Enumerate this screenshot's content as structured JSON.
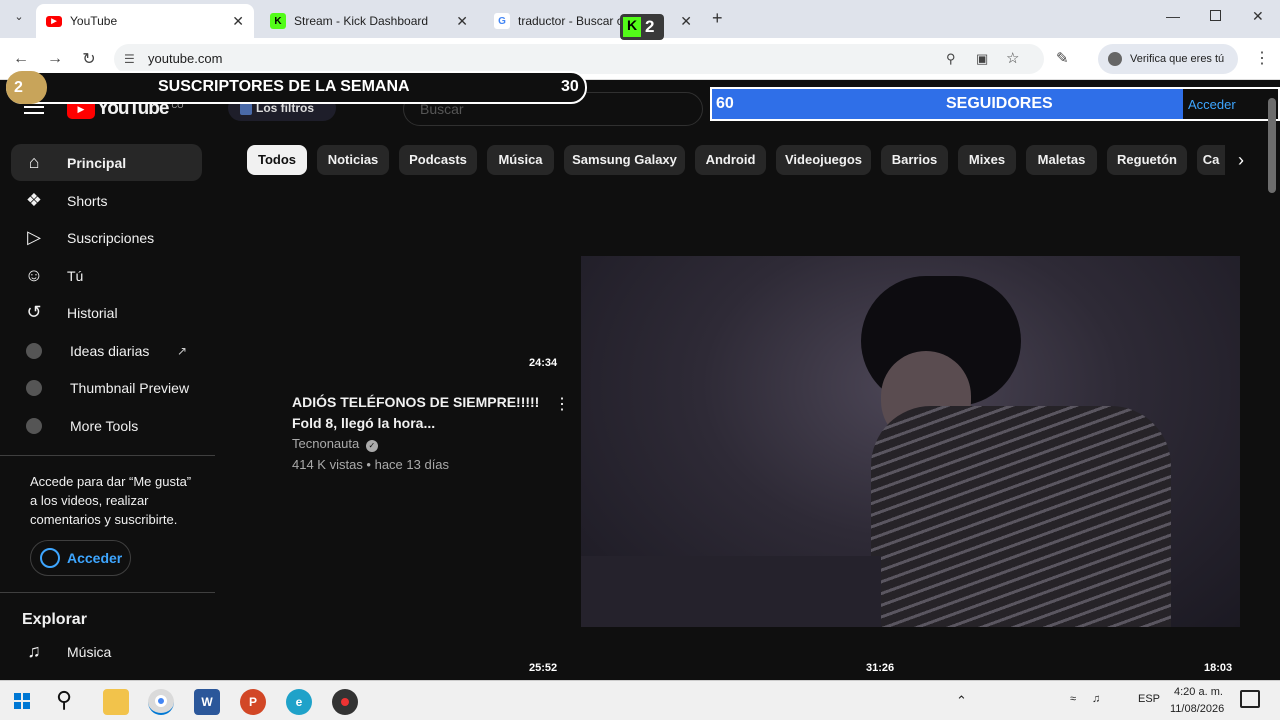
{
  "browser": {
    "tabs": [
      {
        "title": "YouTube",
        "icon": "youtube-icon"
      },
      {
        "title": "Stream - Kick Dashboard",
        "icon": "kick-icon"
      },
      {
        "title": "traductor - Buscar con Google",
        "icon": "google-icon"
      }
    ],
    "new_tab": "+",
    "url": "youtube.com",
    "verify_label": "Verifica que eres tú"
  },
  "overlay": {
    "subs_rank": "2",
    "subs_title": "SUSCRIPTORES DE LA SEMANA",
    "subs_count": "30",
    "followers_count": "60",
    "followers_title": "SEGUIDORES",
    "kick_badge": "2"
  },
  "youtube": {
    "logo": "YouTube",
    "country": "CO",
    "filter_ext": "Los filtros",
    "search_placeholder": "Buscar",
    "signin_label": "Acceder",
    "sidebar": {
      "items": [
        {
          "label": "Principal",
          "icon": "home-icon"
        },
        {
          "label": "Shorts",
          "icon": "shorts-icon"
        },
        {
          "label": "Suscripciones",
          "icon": "subscriptions-icon"
        },
        {
          "label": "Tú",
          "icon": "user-icon"
        },
        {
          "label": "Historial",
          "icon": "history-icon"
        },
        {
          "label": "Ideas diarias",
          "icon": "extension-icon"
        },
        {
          "label": "Thumbnail Preview",
          "icon": "extension-icon"
        },
        {
          "label": "More Tools",
          "icon": "extension-icon"
        }
      ],
      "signin_prompt": "Accede para dar “Me gusta” a los videos, realizar comentarios y suscribirte.",
      "signin_button": "Acceder",
      "explore_title": "Explorar",
      "explore_items": [
        {
          "label": "Música",
          "icon": "music-icon"
        }
      ]
    },
    "chips": [
      "Todos",
      "Noticias",
      "Podcasts",
      "Música",
      "Samsung Galaxy",
      "Android",
      "Videojuegos",
      "Barrios",
      "Mixes",
      "Maletas",
      "Reguetón",
      "Ca"
    ],
    "video": {
      "duration": "24:34",
      "title": "ADIÓS TELÉFONOS DE SIEMPRE!!!!! Fold 8, llegó la hora...",
      "channel": "Tecnonauta",
      "meta": "414 K vistas • hace 13 días"
    },
    "more_durations": [
      "25:52",
      "31:26",
      "18:03"
    ]
  },
  "taskbar": {
    "lang": "ESP",
    "time": "4:20 a. m.",
    "date": "11/08/2026"
  },
  "colors": {
    "youtube_red": "#ff0000",
    "kick_green": "#53fc18",
    "followers_blue": "#2f6fe8"
  }
}
